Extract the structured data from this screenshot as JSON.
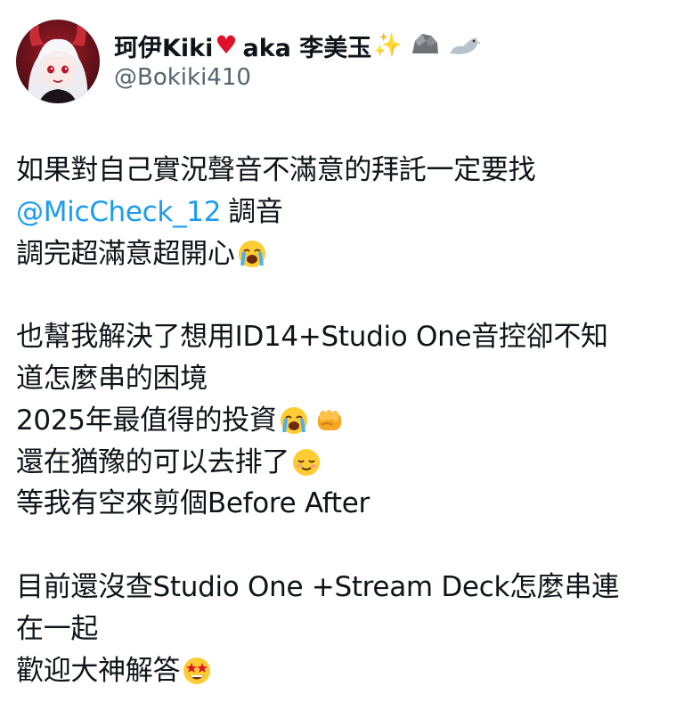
{
  "profile": {
    "display_name_part1": "珂伊Kiki",
    "display_name_part2": "aka 李美玉",
    "handle": "@Bokiki410"
  },
  "tweet": {
    "line1": "如果對自己實況聲音不滿意的拜託一定要找",
    "mention": "@MicCheck_12",
    "line2_tail": "調音",
    "line3": "調完超滿意超開心",
    "line4": "也幫我解決了想用ID14+Studio One音控卻不知",
    "line5": "道怎麼串的困境",
    "line6": "2025年最值得的投資",
    "line7": "還在猶豫的可以去排了",
    "line8": "等我有空來剪個Before After",
    "line9": "目前還沒查Studio One +Stream Deck怎麼串連",
    "line10": "在一起",
    "line11": "歡迎大神解答"
  },
  "colors": {
    "text": "#0f1419",
    "secondary_text": "#536471",
    "link": "#1d9bf0",
    "heart": "#e0102b",
    "emoji_yellow": "#ffcc33"
  },
  "icons": {
    "name_icons": [
      "red-heart-icon",
      "sparkles-icon",
      "rock-icon",
      "seal-icon"
    ],
    "body_icons": [
      "loudly-crying-face-icon",
      "oncoming-fist-icon",
      "relieved-face-icon",
      "star-struck-face-icon"
    ]
  }
}
